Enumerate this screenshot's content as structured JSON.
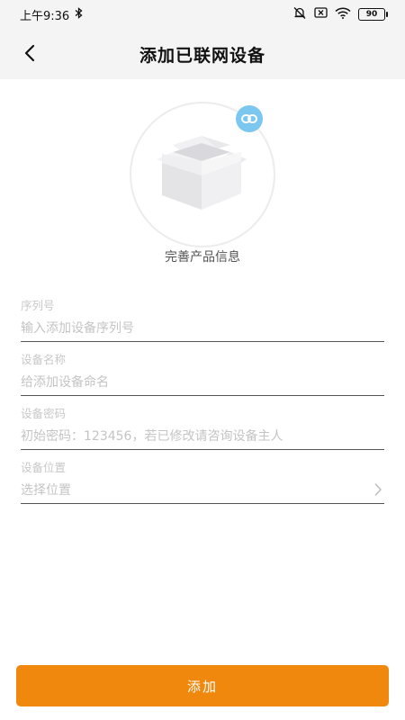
{
  "status_bar": {
    "time": "上午9:36",
    "battery": "90",
    "icons": [
      "bluetooth-icon",
      "mute-icon",
      "no-sim-icon",
      "wifi-icon",
      "battery-icon"
    ]
  },
  "header": {
    "title": "添加已联网设备",
    "back_icon": "chevron-left-icon"
  },
  "illustration": {
    "icons": [
      "open-box-icon",
      "link-icon"
    ],
    "badge_color": "#7cc7ef"
  },
  "subtitle": "完善产品信息",
  "form": {
    "serial": {
      "label": "序列号",
      "placeholder": "输入添加设备序列号"
    },
    "name": {
      "label": "设备名称",
      "placeholder": "给添加设备命名"
    },
    "password": {
      "label": "设备密码",
      "placeholder": "初始密码：123456，若已修改请咨询设备主人"
    },
    "location": {
      "label": "设备位置",
      "placeholder": "选择位置",
      "icon": "chevron-right-icon"
    }
  },
  "actions": {
    "add_label": "添加",
    "accent_color": "#f0880d"
  }
}
